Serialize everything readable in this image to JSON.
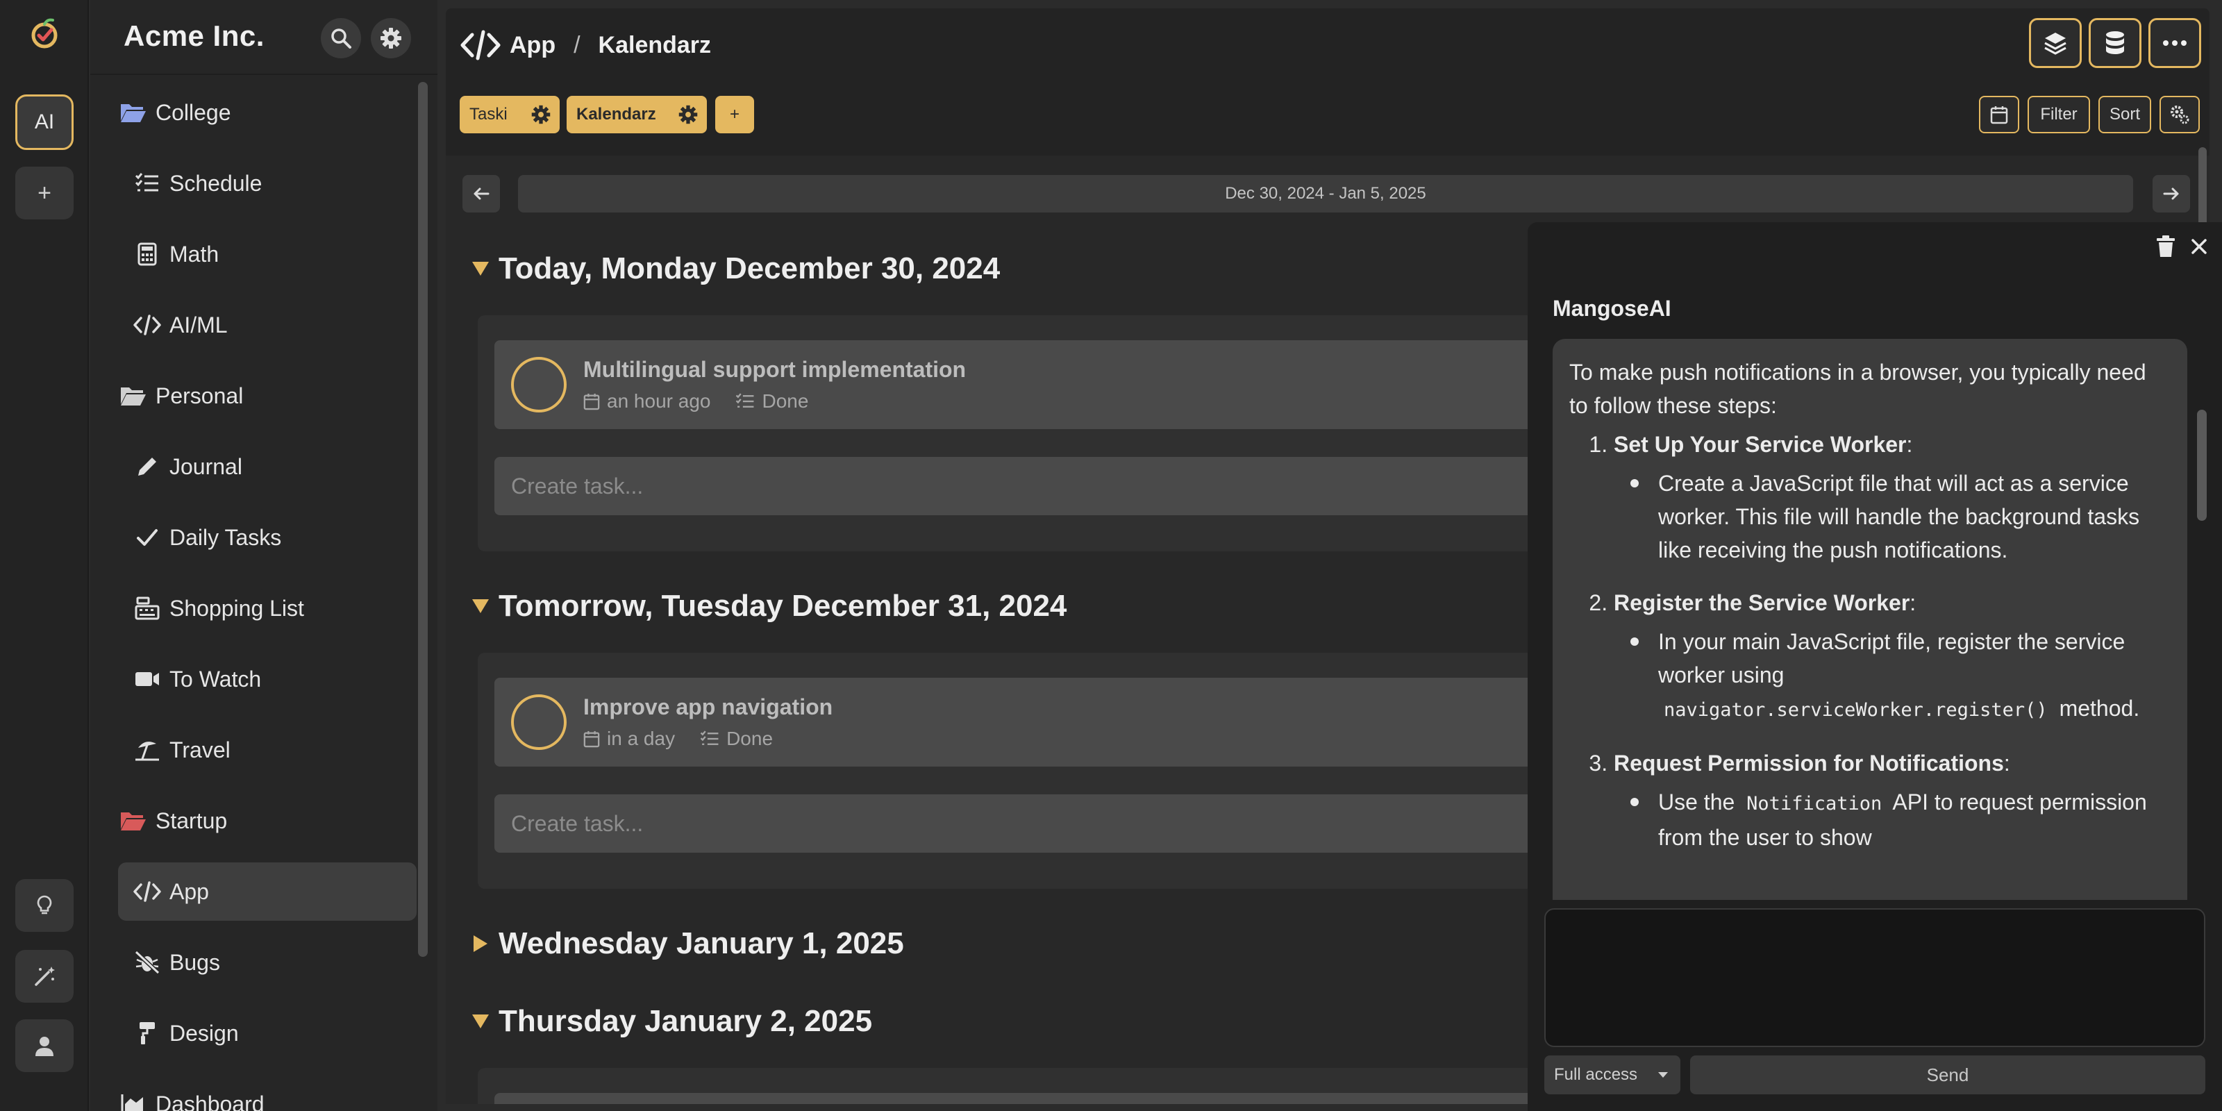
{
  "app": {
    "workspace_title": "Acme Inc.",
    "accent_color": "#e4b860",
    "rail": {
      "ai_label": "AI",
      "add_label": "+"
    }
  },
  "sidebar": {
    "items": [
      {
        "label": "College",
        "icon": "folder-open-icon",
        "kind": "folder",
        "color": "#8ea2e8"
      },
      {
        "label": "Schedule",
        "icon": "checklist-icon",
        "kind": "child"
      },
      {
        "label": "Math",
        "icon": "calculator-icon",
        "kind": "child"
      },
      {
        "label": "AI/ML",
        "icon": "code-icon",
        "kind": "child"
      },
      {
        "label": "Personal",
        "icon": "folder-open-icon",
        "kind": "folder",
        "color": "#cfcfcf"
      },
      {
        "label": "Journal",
        "icon": "pencil-icon",
        "kind": "child"
      },
      {
        "label": "Daily Tasks",
        "icon": "check-icon",
        "kind": "child"
      },
      {
        "label": "Shopping List",
        "icon": "cash-register-icon",
        "kind": "child"
      },
      {
        "label": "To Watch",
        "icon": "video-icon",
        "kind": "child"
      },
      {
        "label": "Travel",
        "icon": "umbrella-beach-icon",
        "kind": "child"
      },
      {
        "label": "Startup",
        "icon": "folder-open-icon",
        "kind": "folder",
        "color": "#d85a5a"
      },
      {
        "label": "App",
        "icon": "code-icon",
        "kind": "child",
        "active": true
      },
      {
        "label": "Bugs",
        "icon": "bug-slash-icon",
        "kind": "child"
      },
      {
        "label": "Design",
        "icon": "paint-roller-icon",
        "kind": "child"
      },
      {
        "label": "Dashboard",
        "icon": "chart-area-icon",
        "kind": "folder"
      }
    ]
  },
  "breadcrumb": {
    "root": "App",
    "separator": "/",
    "current": "Kalendarz"
  },
  "tabs": [
    {
      "label": "Taski"
    },
    {
      "label": "Kalendarz"
    },
    {
      "label": "+"
    }
  ],
  "toolbar": {
    "filter_label": "Filter",
    "sort_label": "Sort"
  },
  "calendar": {
    "range_label": "Dec 30, 2024 - Jan 5, 2025",
    "days": [
      {
        "heading": "Today, Monday December 30, 2024",
        "expanded": true,
        "task": {
          "title": "Multilingual support implementation",
          "when": "an hour ago",
          "status": "Done"
        },
        "create_placeholder": "Create task..."
      },
      {
        "heading": "Tomorrow, Tuesday December 31, 2024",
        "expanded": true,
        "task": {
          "title": "Improve app navigation",
          "when": "in a day",
          "status": "Done"
        },
        "create_placeholder": "Create task..."
      },
      {
        "heading": "Wednesday January 1, 2025",
        "expanded": false
      },
      {
        "heading": "Thursday January 2, 2025",
        "expanded": true
      }
    ]
  },
  "ai_panel": {
    "assistant_name": "MangoseAI",
    "intro": "To make push notifications in a browser, you typically need to follow these steps:",
    "steps": [
      {
        "title": "Set Up Your Service Worker",
        "suffix": ":",
        "bullet": "Create a JavaScript file that will act as a service worker. This file will handle the background tasks like receiving the push notifications."
      },
      {
        "title": "Register the Service Worker",
        "suffix": ":",
        "bullet_pre": "In your main JavaScript file, register the service worker using",
        "bullet_code": "navigator.serviceWorker.register()",
        "bullet_post": "method."
      },
      {
        "title": "Request Permission for Notifications",
        "suffix": ":",
        "bullet_pre": "Use the",
        "bullet_code": "Notification",
        "bullet_post": "API to request permission from the user to show"
      }
    ],
    "access_label": "Full access",
    "send_label": "Send"
  }
}
